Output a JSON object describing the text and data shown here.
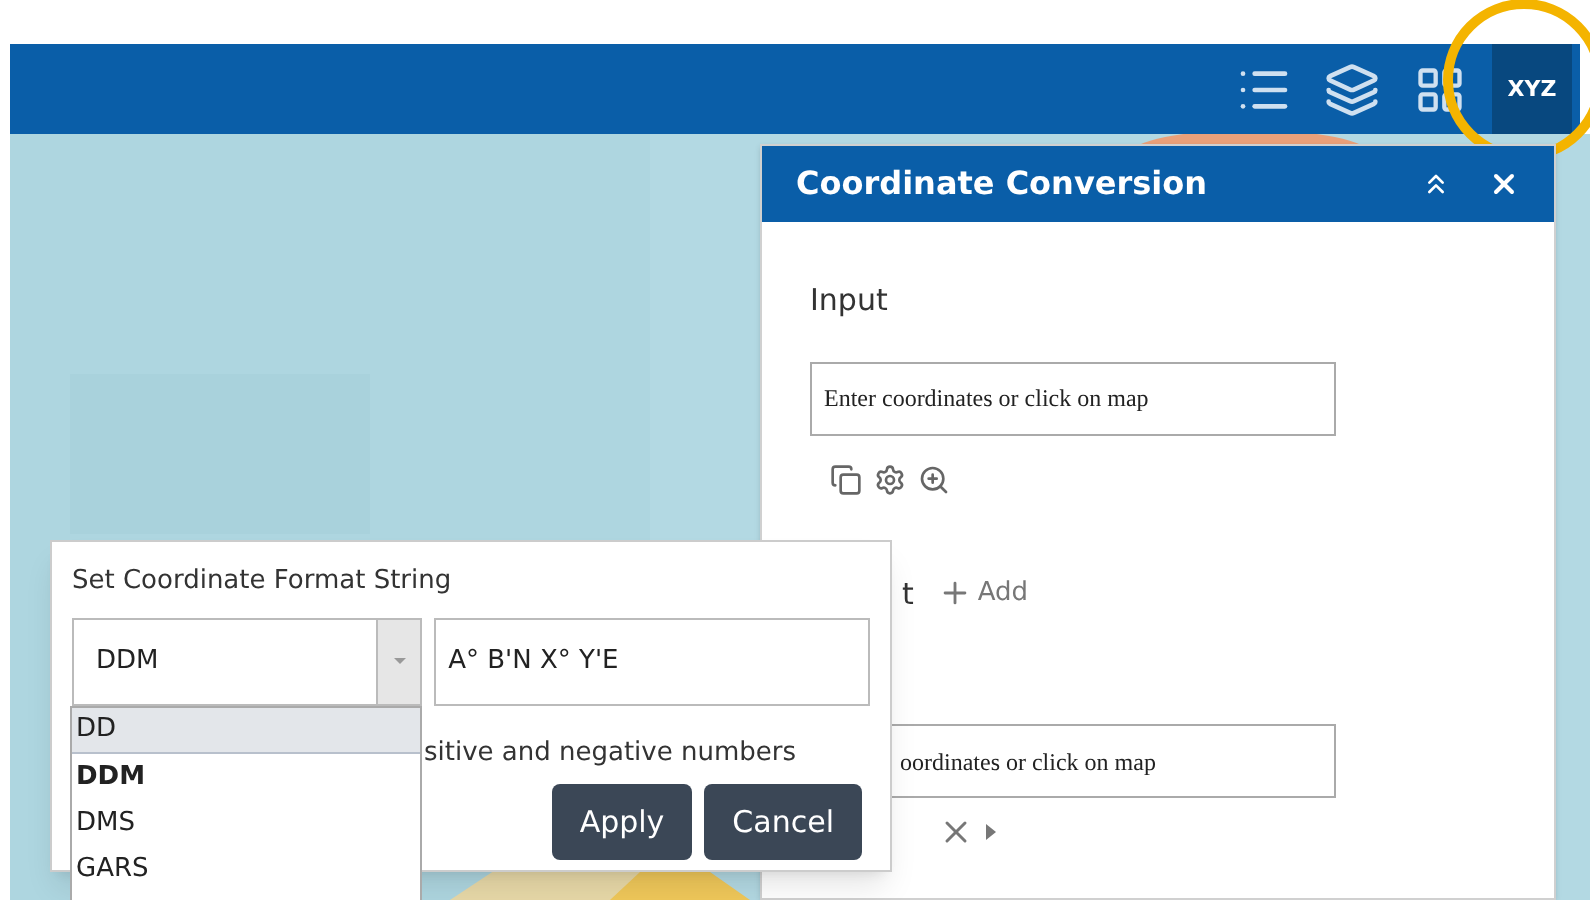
{
  "toolbar": {
    "buttons": [
      {
        "kind": "list",
        "selected": false
      },
      {
        "kind": "layers",
        "selected": false
      },
      {
        "kind": "grid",
        "selected": false
      },
      {
        "kind": "xyz",
        "label": "XYZ",
        "selected": true,
        "highlighted": true
      }
    ]
  },
  "panel": {
    "title": "Coordinate Conversion",
    "input": {
      "label": "Input",
      "placeholder": "Enter coordinates or click on map"
    },
    "output": {
      "label": "t",
      "add": "Add",
      "placeholder": "oordinates or click on map"
    }
  },
  "format_popup": {
    "title": "Set Coordinate Format String",
    "format": "DDM",
    "format_string": "A° B'N X° Y'E",
    "hint": "sitive and negative numbers",
    "buttons": [
      "Apply",
      "Cancel"
    ]
  },
  "format_options": [
    {
      "label": "DD",
      "selected": false,
      "highlighted": true
    },
    {
      "label": "DDM",
      "selected": true,
      "highlighted": false
    },
    {
      "label": "DMS",
      "selected": false,
      "highlighted": false
    },
    {
      "label": "GARS",
      "selected": false,
      "highlighted": false
    }
  ]
}
